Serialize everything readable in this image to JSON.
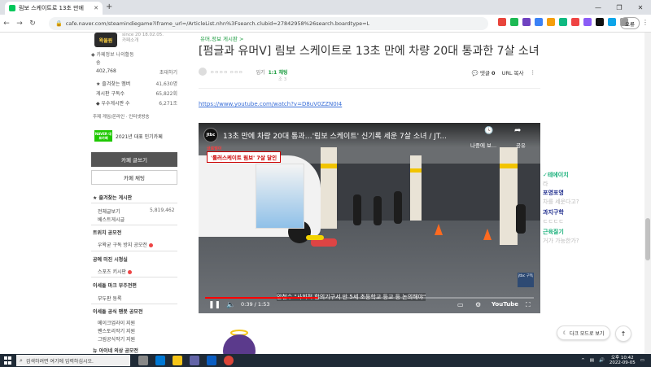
{
  "browser": {
    "tab_title": "림보 스케이트로 13초 만에",
    "url": "cafe.naver.com/steamindiegame?iframe_url=/ArticleList.nhn%3Fsearch.clubid=27842958%26search.boardtype=L",
    "profile_label": "오류"
  },
  "sidebar": {
    "logo_text": "왁물원",
    "meta_line1": "since 20 18.02.05.",
    "meta_line2": "카페소개",
    "cafe_info": "◆ 카페정보   나의활동",
    "stats": [
      {
        "label": "송",
        "value": ""
      },
      {
        "label": "402,768",
        "value": "초대하기"
      },
      {
        "label": "★ 즐겨찾는 멤버",
        "value": "41,630명"
      },
      {
        "label": "게시판 구독수",
        "value": "65,822회"
      },
      {
        "label": "◆ 우수게시판 수",
        "value": "6,271조"
      }
    ],
    "tabs_small": "주제 게임/온라인 · 인터넷방송",
    "badge": "NAVER 대표카페",
    "badge_text": "2021년 대표 인기카페",
    "write_btn": "카페 글쓰기",
    "chat_btn": "카페 채팅",
    "fav_section": "★ 즐겨찾는 게시판",
    "menu": [
      {
        "label": "전체글보기",
        "count": "5,819,462"
      },
      {
        "label": "베스트게시글",
        "count": ""
      }
    ],
    "section2": "트위치 공모전",
    "item2": "우왁굳 구독 방지 공모전",
    "section3": "공예 미진 시청실",
    "item3": "스포츠 키시판",
    "section4": "이세돌 마크 부주전편",
    "item4": "부두판 동록",
    "section5": "이세돌 공식 팬봇 공모전",
    "items5": [
      "메이크업라이 지원",
      "팬스토리작기 지원",
      "그림공식작기 지원"
    ],
    "section6": "뉴 아이네 의상 공모전"
  },
  "article": {
    "board_link": "유머,정보 게시판 >",
    "title": "[펌글과 유머ᐯ] 림보 스케이트로 13초 만에 차량 20대 통과한 7살 소녀",
    "author_name": "ㅇㅇㅇㅇ ㅇㅇㅇ",
    "grade": "임기",
    "chat_tag": "1:1 채팅",
    "date": "조 3",
    "comment_label": "댓글",
    "comment_count": "0",
    "url_copy": "URL 복사",
    "youtube_link": "https://www.youtube.com/watch?v=D8uV0ZZN0I4"
  },
  "video": {
    "channel_logo": "jtbc",
    "title": "13초 만에 차량 20대 통과…'림보 스케이트' 신기록 세운 7살 소녀 / JT...",
    "clock_label": "나중에 보...",
    "share_label": "공유",
    "news_tag": "글로벌이",
    "news_banner": "'롤러스케이트 림보' 7살 달인",
    "corner": "jtbc 구독",
    "caption": "안철수 \"사회적 합의기구서 만 5세 초등학교 등교 등 논의해야\"",
    "time": "0:39 / 1:53",
    "progress": 0.345,
    "yt_logo": "YouTube"
  },
  "rightpanel": {
    "items": [
      {
        "text": "✓테에이치",
        "style": "green"
      },
      {
        "text": "라",
        "style": "gray"
      },
      {
        "text": "포영포영",
        "style": "bold"
      },
      {
        "text": "차를 세운다고?",
        "style": "gray"
      },
      {
        "text": "과지구학",
        "style": "bold"
      },
      {
        "text": "ㄷㄷㄷㄷ",
        "style": "gray"
      },
      {
        "text": "근육질기",
        "style": "green"
      },
      {
        "text": "거가 가능한가?",
        "style": "gray"
      }
    ],
    "dark_mode": "다크 모드로 보기"
  },
  "taskbar": {
    "search_placeholder": "검색하려면 여기에 입력하십시오.",
    "time": "오후 10:42",
    "date": "2022-09-05"
  }
}
